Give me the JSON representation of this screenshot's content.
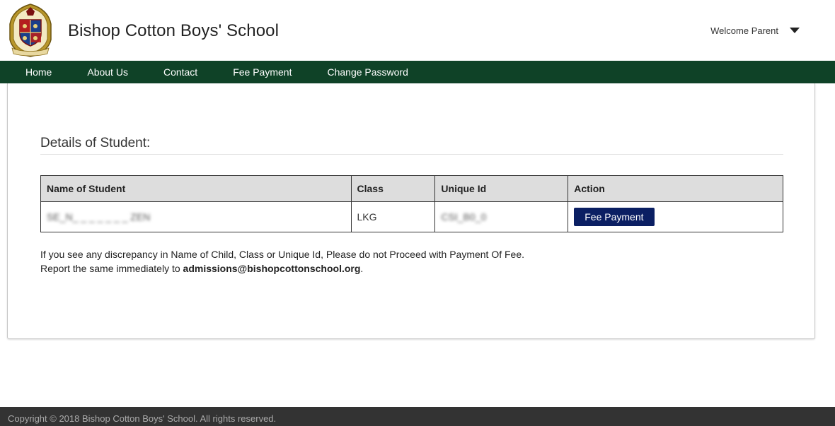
{
  "header": {
    "school_name": "Bishop Cotton Boys' School",
    "welcome": "Welcome Parent"
  },
  "nav": {
    "items": [
      {
        "label": "Home"
      },
      {
        "label": "About Us"
      },
      {
        "label": "Contact"
      },
      {
        "label": "Fee Payment"
      },
      {
        "label": "Change Password"
      }
    ]
  },
  "main": {
    "section_title": "Details of Student:",
    "table": {
      "headers": [
        "Name of Student",
        "Class",
        "Unique Id",
        "Action"
      ],
      "rows": [
        {
          "name": "SE_N_ _ _ _ _ _ _ ZEN",
          "class": "LKG",
          "unique_id": "CSI_B0_0",
          "action": "Fee Payment"
        }
      ]
    },
    "notice": {
      "line1": "If you see any discrepancy in Name of Child, Class or Unique Id, Please do not Proceed with Payment Of Fee.",
      "line2_prefix": "Report the same immediately to ",
      "email": "admissions@bishopcottonschool.org",
      "line2_suffix": "."
    }
  },
  "footer": {
    "copyright": "Copyright © 2018 Bishop Cotton Boys' School. All rights reserved."
  },
  "colors": {
    "nav_bg": "#0f4227",
    "button_bg": "#0b1f63",
    "footer_bg": "#333333"
  },
  "icons": {
    "logo": "school-crest-icon",
    "user_menu": "caret-down-icon"
  }
}
